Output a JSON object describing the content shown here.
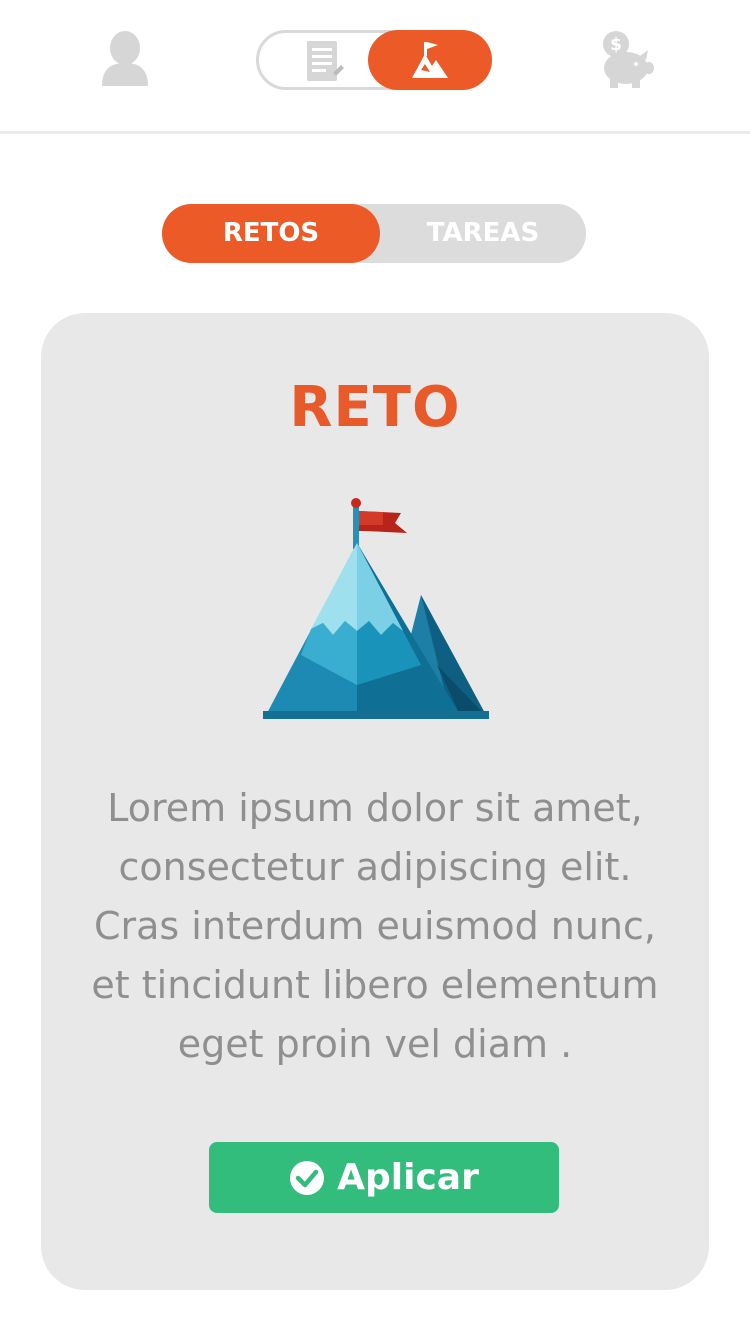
{
  "header": {
    "icons": {
      "profile": "person-icon",
      "list": "document-list-icon",
      "challenge": "mountain-flag-icon",
      "savings": "piggy-bank-icon"
    }
  },
  "tabs": {
    "retos_label": "RETOS",
    "tareas_label": "TAREAS",
    "active": "RETOS"
  },
  "card": {
    "title": "RETO",
    "illustration": "mountain-flag-illustration",
    "body": "Lorem ipsum dolor sit amet, consectetur adipiscing elit. Cras interdum euismod nunc, et tincidunt libero elementum eget proin vel diam .",
    "button_label": "Aplicar"
  },
  "colors": {
    "accent": "#ec5a28",
    "success": "#33bd7d",
    "inactive": "#dcdcdc",
    "card_bg": "#e8e8e9",
    "body_text": "#8f8f8f"
  }
}
